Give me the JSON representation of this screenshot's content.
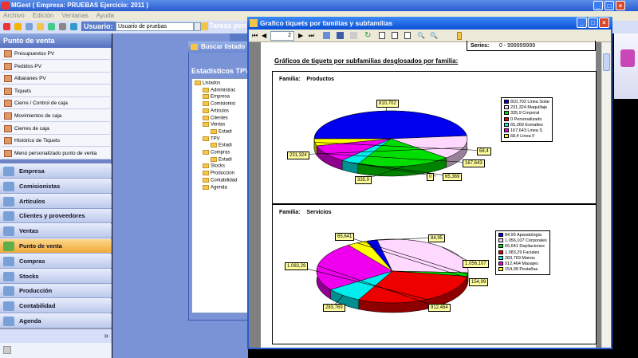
{
  "app": {
    "title": "MGest ( Empresa: PRUEBAS Ejercicio: 2011 )",
    "menu": [
      "Archivo",
      "Edición",
      "Ventanas",
      "Ayuda"
    ],
    "user_label": "Usuario:",
    "user_value": "Usuario de pruebas",
    "tareas_label": "Tareas pen"
  },
  "sidebar": {
    "header": "Punto de venta",
    "sub_items": [
      {
        "label": "Presupuestos PV"
      },
      {
        "label": "Pedidos PV"
      },
      {
        "label": "Albaranes PV"
      },
      {
        "label": "Tiquets"
      },
      {
        "label": "Cierre / Control de caja"
      },
      {
        "label": "Movimientos de caja"
      },
      {
        "label": "Cierres de caja"
      },
      {
        "label": "Histórico de Tiquets"
      },
      {
        "label": "Menú personalizado punto de venta"
      }
    ],
    "modules": [
      {
        "label": "Empresa"
      },
      {
        "label": "Comisionistas"
      },
      {
        "label": "Artículos"
      },
      {
        "label": "Clientes y proveedores"
      },
      {
        "label": "Ventas"
      },
      {
        "label": "Punto de venta"
      },
      {
        "label": "Compras"
      },
      {
        "label": "Stocks"
      },
      {
        "label": "Producción"
      },
      {
        "label": "Contabilidad"
      },
      {
        "label": "Agenda"
      }
    ]
  },
  "buscar": {
    "title": "Buscar listado",
    "subtitle": "Estadísticos TPV",
    "tree": [
      {
        "label": "Listados",
        "level": 0
      },
      {
        "label": "Administrac",
        "level": 1
      },
      {
        "label": "Empresa",
        "level": 1
      },
      {
        "label": "Comisionist",
        "level": 1
      },
      {
        "label": "Articulos",
        "level": 1
      },
      {
        "label": "Clientes",
        "level": 1
      },
      {
        "label": "Ventas",
        "level": 1
      },
      {
        "label": "Estadi",
        "level": 2
      },
      {
        "label": "TPV",
        "level": 1
      },
      {
        "label": "Estadi",
        "level": 2
      },
      {
        "label": "Compras",
        "level": 1
      },
      {
        "label": "Estadi",
        "level": 2
      },
      {
        "label": "Stocks",
        "level": 1
      },
      {
        "label": "Produccion",
        "level": 1
      },
      {
        "label": "Contabilidad",
        "level": 1
      },
      {
        "label": "Agenda",
        "level": 1
      }
    ]
  },
  "report": {
    "title": "Grafico tiquets por familias y subfamilias",
    "page": "2",
    "series_label": "Series:",
    "series_value": "0 - 999999999",
    "heading": "Gráficos de tiquets por subfamilias desglosados por familia:",
    "family_prefix": "Familia:"
  },
  "chart_data": [
    {
      "type": "pie",
      "title": "Productos",
      "slices": [
        {
          "label": "Linea Solar",
          "value": 810.702,
          "display": "810,702",
          "color": "#0000ee"
        },
        {
          "label": "Maquillaje",
          "value": 231.324,
          "display": "231,324",
          "color": "#ffd8ff"
        },
        {
          "label": "Corporal",
          "value": 335.9,
          "display": "335,9",
          "color": "#00dd00"
        },
        {
          "label": "Personalizado",
          "value": 0,
          "display": "0",
          "color": "#ee0000"
        },
        {
          "label": "Esmaltes",
          "value": 65.369,
          "display": "65,369",
          "color": "#00eeee"
        },
        {
          "label": "Linea S",
          "value": 167.643,
          "display": "167,643",
          "color": "#ee00ee"
        },
        {
          "label": "Linea F",
          "value": 68.4,
          "display": "68,4",
          "color": "#ffff00"
        }
      ],
      "legend_text": [
        "810,702 Linea Solar",
        "231,324 Maquillaje",
        "335,9 Corporal",
        "0 Personalizado",
        "65,369 Esmaltes",
        "167,643 Linea S",
        "68,4 Linea F"
      ]
    },
    {
      "type": "pie",
      "title": "Servicios",
      "slices": [
        {
          "label": "Aparatologia",
          "value": 84.95,
          "display": "84,95",
          "color": "#0000ee"
        },
        {
          "label": "Corporales",
          "value": 1056.107,
          "display": "1.056,107",
          "color": "#ffd8ff"
        },
        {
          "label": "Depilaciones",
          "value": 65.641,
          "display": "65,641",
          "color": "#00dd00"
        },
        {
          "label": "Faciales",
          "value": 1083.29,
          "display": "1.083,29",
          "color": "#ee0000"
        },
        {
          "label": "Manos",
          "value": 283.769,
          "display": "283,769",
          "color": "#00eeee"
        },
        {
          "label": "Masajes",
          "value": 912.464,
          "display": "912,464",
          "color": "#ee00ee"
        },
        {
          "label": "Pestañas",
          "value": 154.99,
          "display": "154,99",
          "color": "#ffff00"
        }
      ],
      "legend_text": [
        "84,95 Aparatologia",
        "1.056,107 Corporales",
        "65,641 Depilaciones",
        "1.083,29 Faciales",
        "283,769 Manos",
        "912,464 Masajes",
        "154,99 Pestañas"
      ]
    }
  ]
}
